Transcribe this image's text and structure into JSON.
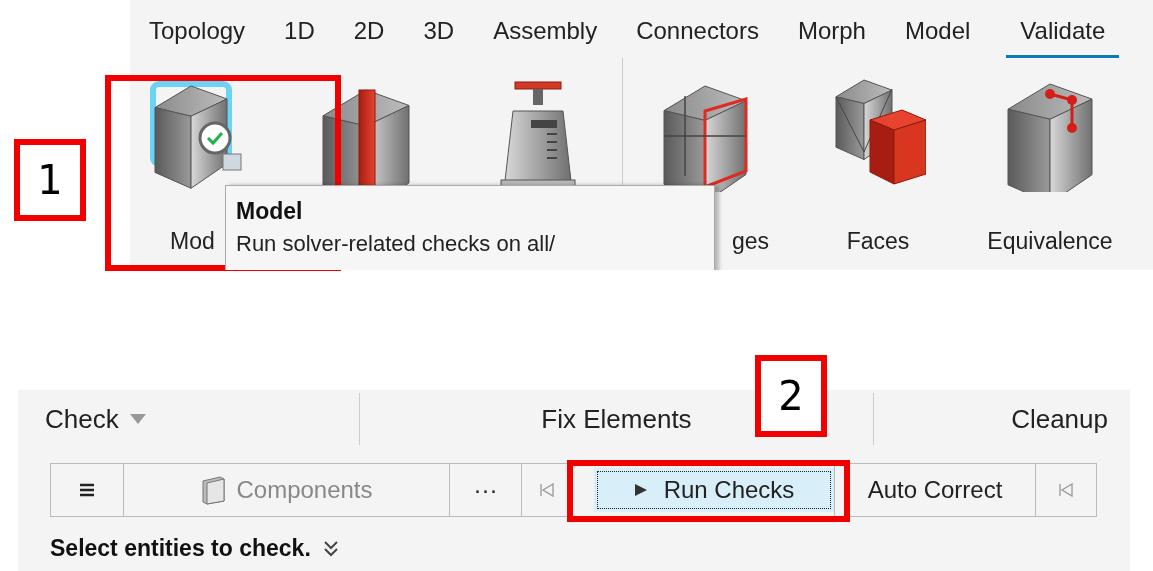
{
  "ribbon": {
    "tabs": [
      {
        "label": "Topology",
        "selected": false
      },
      {
        "label": "1D",
        "selected": false
      },
      {
        "label": "2D",
        "selected": false
      },
      {
        "label": "3D",
        "selected": false
      },
      {
        "label": "Assembly",
        "selected": false
      },
      {
        "label": "Connectors",
        "selected": false
      },
      {
        "label": "Morph",
        "selected": false
      },
      {
        "label": "Model",
        "selected": false
      },
      {
        "label": "Validate",
        "selected": true
      }
    ],
    "groups": [
      {
        "tools": [
          {
            "kind": "model",
            "label": "Mod",
            "highlighted": true
          },
          {
            "kind": "split"
          },
          {
            "kind": "scale"
          }
        ]
      },
      {
        "tools": [
          {
            "kind": "edges",
            "label": "ges",
            "highlighted": false
          },
          {
            "kind": "faces",
            "label": "Faces",
            "highlighted": false
          },
          {
            "kind": "equivalence",
            "label": "Equivalence",
            "highlighted": false
          }
        ]
      }
    ],
    "tooltip": {
      "title": "Model",
      "text": "Run solver-related checks on all/"
    }
  },
  "check_panel": {
    "sections": [
      {
        "kind": "dropdown",
        "label": "Check"
      },
      {
        "kind": "plain",
        "label": "Fix Elements"
      },
      {
        "kind": "plain",
        "label": "Cleanup"
      }
    ],
    "toolbar": [
      {
        "kind": "menu",
        "selected": false
      },
      {
        "kind": "entity",
        "label": "Components",
        "selected": false
      },
      {
        "kind": "text",
        "label": "···",
        "selected": false
      },
      {
        "kind": "first",
        "selected": false
      },
      {
        "kind": "run",
        "label": "Run Checks",
        "selected": true
      },
      {
        "kind": "text",
        "label": "Auto Correct",
        "selected": false
      },
      {
        "kind": "first",
        "selected": false
      }
    ],
    "prompt": "Select entities to check."
  },
  "annotations": [
    {
      "number": "1"
    },
    {
      "number": "2"
    }
  ]
}
